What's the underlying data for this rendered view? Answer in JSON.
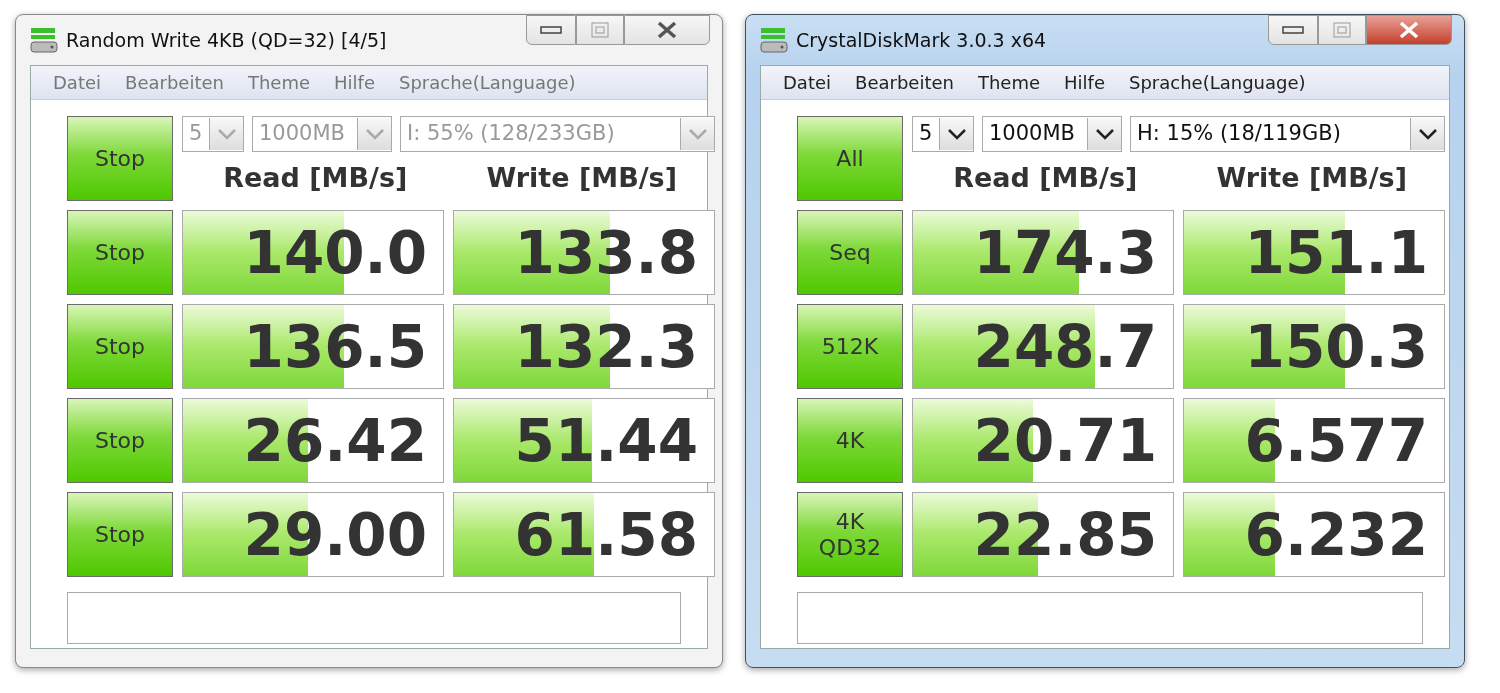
{
  "windows": [
    {
      "title": "Random Write 4KB (QD=32) [4/5]",
      "active": false,
      "menu": [
        "Datei",
        "Bearbeiten",
        "Theme",
        "Hilfe",
        "Sprache(Language)"
      ],
      "main_button": "Stop",
      "selects": [
        {
          "value": "5",
          "disabled": true
        },
        {
          "value": "1000MB",
          "disabled": true
        },
        {
          "value": "I: 55% (128/233GB)",
          "disabled": true
        }
      ],
      "headers": [
        "Read [MB/s]",
        "Write [MB/s]"
      ],
      "rows": [
        {
          "button": "Stop",
          "read": {
            "value": "140.0",
            "level": 0.62
          },
          "write": {
            "value": "133.8",
            "level": 0.6
          }
        },
        {
          "button": "Stop",
          "read": {
            "value": "136.5",
            "level": 0.62
          },
          "write": {
            "value": "132.3",
            "level": 0.6
          }
        },
        {
          "button": "Stop",
          "read": {
            "value": "26.42",
            "level": 0.48
          },
          "write": {
            "value": "51.44",
            "level": 0.53
          }
        },
        {
          "button": "Stop",
          "read": {
            "value": "29.00",
            "level": 0.48
          },
          "write": {
            "value": "61.58",
            "level": 0.54
          }
        }
      ]
    },
    {
      "title": "CrystalDiskMark 3.0.3 x64",
      "active": true,
      "menu": [
        "Datei",
        "Bearbeiten",
        "Theme",
        "Hilfe",
        "Sprache(Language)"
      ],
      "main_button": "All",
      "selects": [
        {
          "value": "5",
          "disabled": false
        },
        {
          "value": "1000MB",
          "disabled": false
        },
        {
          "value": "H: 15% (18/119GB)",
          "disabled": false
        }
      ],
      "headers": [
        "Read [MB/s]",
        "Write [MB/s]"
      ],
      "rows": [
        {
          "button": "Seq",
          "read": {
            "value": "174.3",
            "level": 0.64
          },
          "write": {
            "value": "151.1",
            "level": 0.62
          }
        },
        {
          "button": "512K",
          "read": {
            "value": "248.7",
            "level": 0.7
          },
          "write": {
            "value": "150.3",
            "level": 0.62
          }
        },
        {
          "button": "4K",
          "read": {
            "value": "20.71",
            "level": 0.46
          },
          "write": {
            "value": "6.577",
            "level": 0.35
          }
        },
        {
          "button": "4K\nQD32",
          "read": {
            "value": "22.85",
            "level": 0.48
          },
          "write": {
            "value": "6.232",
            "level": 0.35
          }
        }
      ]
    }
  ]
}
